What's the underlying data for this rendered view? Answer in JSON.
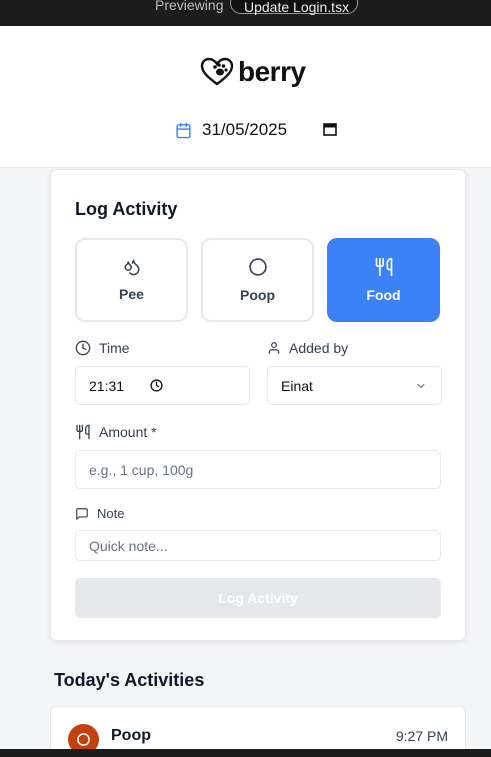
{
  "preview_bar": {
    "label": "Previewing",
    "file": "Update Login.tsx"
  },
  "brand": {
    "name": "berry"
  },
  "date": {
    "value": "31/05/2025"
  },
  "form": {
    "title": "Log Activity",
    "types": [
      {
        "label": "Pee",
        "icon": "droplets-icon",
        "active": false
      },
      {
        "label": "Poop",
        "icon": "circle-icon",
        "active": false
      },
      {
        "label": "Food",
        "icon": "utensils-icon",
        "active": true
      }
    ],
    "time_label": "Time",
    "time_value": "21:31",
    "added_by_label": "Added by",
    "added_by_value": "Einat",
    "amount_label": "Amount *",
    "amount_placeholder": "e.g., 1 cup, 100g",
    "note_label": "Note",
    "note_placeholder": "Quick note...",
    "submit_label": "Log Activity"
  },
  "activities": {
    "title": "Today's Activities",
    "items": [
      {
        "name": "Poop",
        "time": "9:27 PM",
        "color": "#c2410c"
      }
    ]
  },
  "colors": {
    "accent": "#3b82f6",
    "poop": "#c2410c"
  }
}
